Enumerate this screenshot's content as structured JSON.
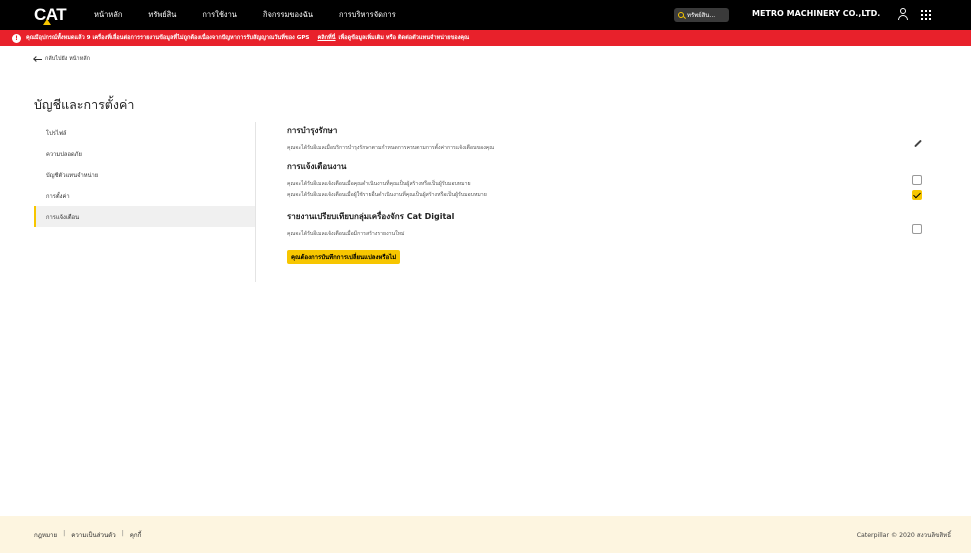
{
  "header": {
    "logo": "CAT",
    "nav": [
      "หน้าหลัก",
      "ทรัพย์สิน",
      "การใช้งาน",
      "กิจกรรมของฉัน",
      "การบริหารจัดการ"
    ],
    "search_label": "ทรัพย์สิน...",
    "company": "METRO MACHINERY CO.,LTD."
  },
  "alert": {
    "icon": "!",
    "message": "คุณมีอุปกรณ์ทั้งหมดแล้ว 9 เครื่องที่เลื่อนต่อการรายงานข้อมูลที่ไม่ถูกต้องเนื่องจากปัญหาการรับสัญญาณวันที่ของ GPS",
    "link": "คลิกที่นี่",
    "tail": "เพื่อดูข้อมูลเพิ่มเติม หรือ ติดต่อตัวแทนจำหน่ายของคุณ"
  },
  "back_link": "กลับไปยัง หน้าหลัก",
  "page_title": "บัญชีและการตั้งค่า",
  "sidebar": {
    "items": [
      "โปรไฟล์",
      "ความปลอดภัย",
      "บัญชีตัวแทนจำหน่าย",
      "การตั้งค่า",
      "การแจ้งเตือน"
    ],
    "active_index": 4
  },
  "sections": {
    "maintenance": {
      "title": "การบำรุงรักษา",
      "desc": "คุณจะได้รับอีเมลเมื่อบริการบำรุงรักษาตามกำหนดการครบตามการตั้งค่าการแจ้งเตือนของคุณ"
    },
    "alerts": {
      "title": "การแจ้งเตือนงาน",
      "desc1": "คุณจะได้รับอีเมลแจ้งเตือนเมื่อคุณดำเนินงานที่คุณเป็นผู้สร้างหรือเป็นผู้รับมอบหมาย",
      "desc2": "คุณจะได้รับอีเมลแจ้งเตือนเมื่อผู้ใช้รายอื่นดำเนินงานที่คุณเป็นผู้สร้างหรือเป็นผู้รับมอบหมาย",
      "checkbox1_checked": false,
      "checkbox2_checked": true
    },
    "report": {
      "title": "รายงานเปรียบเทียบกลุ่มเครื่องจักร Cat Digital",
      "desc": "คุณจะได้รับอีเมลแจ้งเตือนเมื่อมีการสร้างรายงานใหม่",
      "checkbox_checked": false
    }
  },
  "save_button": "คุณต้องการบันทึกการเปลี่ยนแปลงหรือไม่",
  "footer": {
    "links": [
      "กฎหมาย",
      "ความเป็นส่วนตัว",
      "คุกกี้"
    ],
    "copyright": "Caterpillar © 2020 สงวนลิขสิทธิ์"
  },
  "colors": {
    "accent": "#f7c600",
    "alert": "#e8212b",
    "nav": "#000000",
    "footer": "#fdf5e0"
  }
}
